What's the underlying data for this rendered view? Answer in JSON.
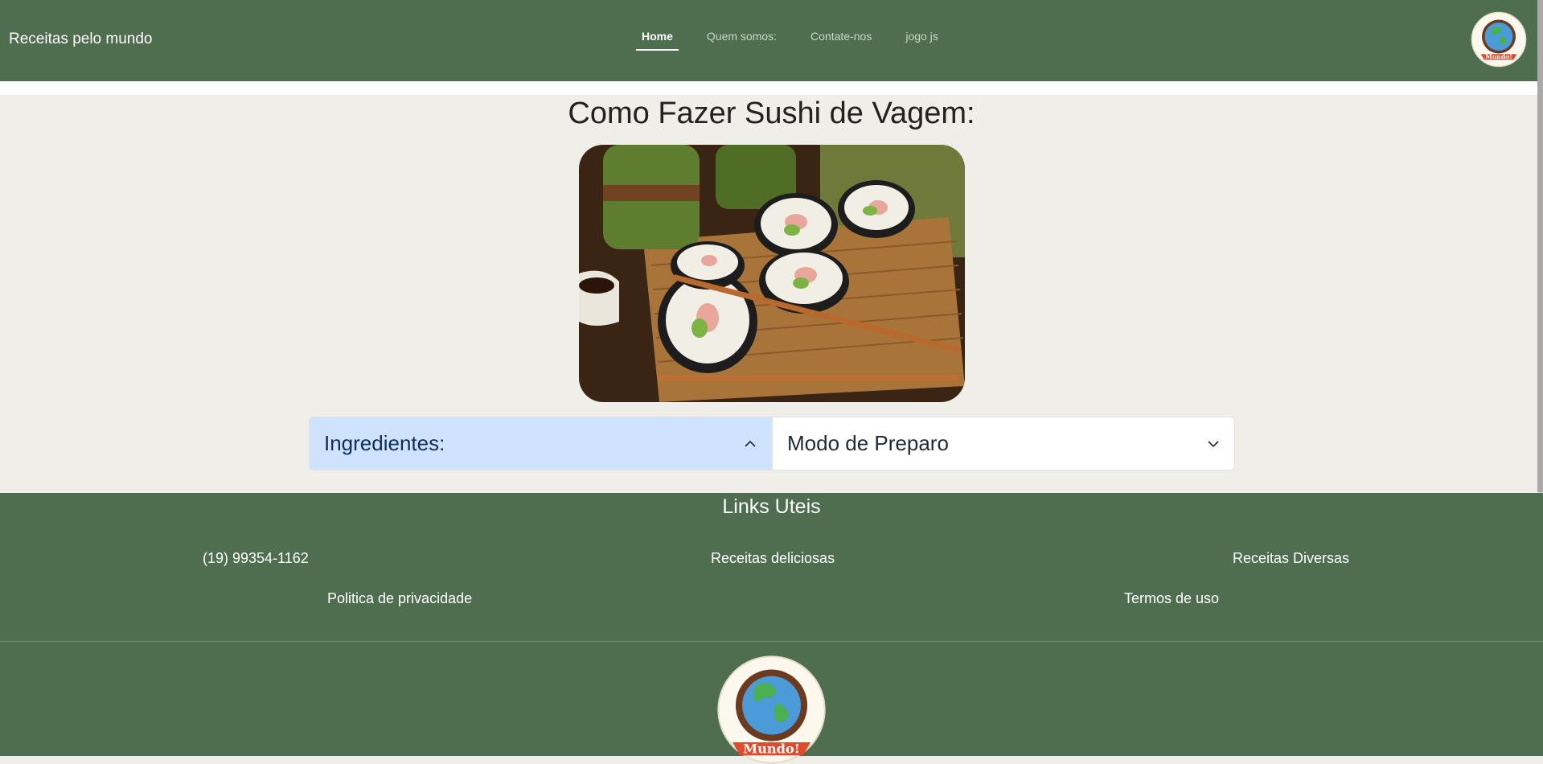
{
  "navbar": {
    "brand": "Receitas pelo mundo",
    "links": [
      {
        "label": "Home",
        "active": true
      },
      {
        "label": "Quem somos:",
        "active": false
      },
      {
        "label": "Contate-nos",
        "active": false
      },
      {
        "label": "jogo js",
        "active": false
      }
    ],
    "logo_icon": "globe-logo-icon"
  },
  "main": {
    "title": "Como Fazer Sushi de Vagem:",
    "image_icon": "sushi-photo",
    "accordion": [
      {
        "label": "Ingredientes:",
        "expanded": true,
        "icon": "chevron-up-icon"
      },
      {
        "label": "Modo de Preparo",
        "expanded": false,
        "icon": "chevron-down-icon"
      }
    ]
  },
  "footer": {
    "title": "Links Uteis",
    "links": {
      "phone": "(19) 99354-1162",
      "recipes_delicious": "Receitas deliciosas",
      "recipes_various": "Receitas Diversas",
      "privacy": "Politica de privacidade",
      "terms": "Termos de uso"
    },
    "logo_icon": "globe-logo-icon"
  },
  "colors": {
    "nav_bg": "#4f6e50",
    "page_bg": "#f0eee8",
    "accordion_open_bg": "#cfe2ff"
  }
}
